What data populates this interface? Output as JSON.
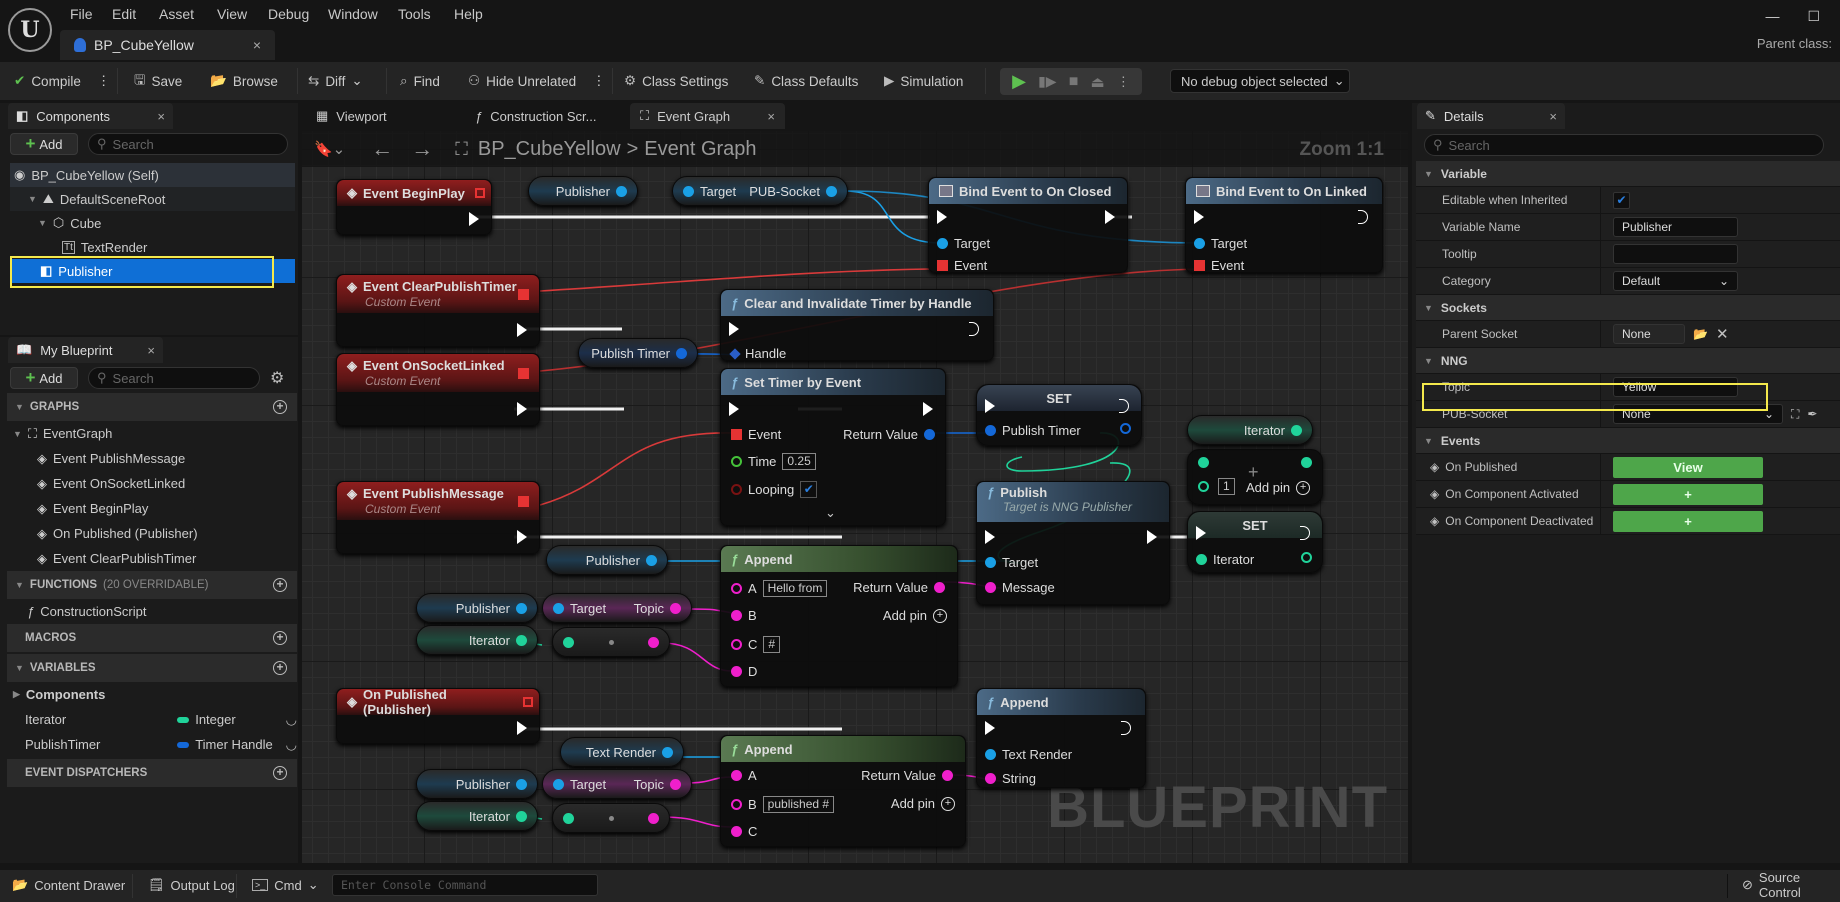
{
  "window": {
    "menu": [
      "File",
      "Edit",
      "Asset",
      "View",
      "Debug",
      "Window",
      "Tools",
      "Help"
    ],
    "doc_tab": "BP_CubeYellow",
    "parent_class_label": "Parent class:",
    "controls": {
      "minimize": "—",
      "maximize": "☐"
    }
  },
  "toolbar": {
    "compile": "Compile",
    "save": "Save",
    "browse": "Browse",
    "diff": "Diff",
    "find": "Find",
    "hide_unrelated": "Hide Unrelated",
    "class_settings": "Class Settings",
    "class_defaults": "Class Defaults",
    "simulation": "Simulation",
    "debug_object": "No debug object selected",
    "play_color": "#5ec150"
  },
  "components": {
    "tab": "Components",
    "add": "Add",
    "search_placeholder": "Search",
    "tree": [
      {
        "label": "BP_CubeYellow (Self)",
        "level": 0
      },
      {
        "label": "DefaultSceneRoot",
        "level": 1
      },
      {
        "label": "Cube",
        "level": 2
      },
      {
        "label": "TextRender",
        "level": 3
      },
      {
        "label": "Publisher",
        "level": 1,
        "selected": true
      }
    ]
  },
  "my_blueprint": {
    "tab": "My Blueprint",
    "add": "Add",
    "search_placeholder": "Search",
    "graphs_header": "GRAPHS",
    "event_graph": "EventGraph",
    "graph_items": [
      "Event PublishMessage",
      "Event OnSocketLinked",
      "Event BeginPlay",
      "On Published (Publisher)",
      "Event ClearPublishTimer"
    ],
    "functions_header": "FUNCTIONS",
    "functions_note": "(20 OVERRIDABLE)",
    "functions": [
      "ConstructionScript"
    ],
    "macros_header": "MACROS",
    "variables_header": "VARIABLES",
    "components_group": "Components",
    "variables": [
      {
        "name": "Iterator",
        "type": "Integer",
        "color": "#20d39a"
      },
      {
        "name": "PublishTimer",
        "type": "Timer Handle",
        "color": "#1468d8"
      }
    ],
    "dispatchers_header": "EVENT DISPATCHERS"
  },
  "graph_tabs": {
    "viewport": "Viewport",
    "construction": "Construction Scr...",
    "event_graph": "Event Graph"
  },
  "graph": {
    "breadcrumb_root": "BP_CubeYellow",
    "breadcrumb_sep": ">",
    "breadcrumb_leaf": "Event Graph",
    "zoom": "Zoom 1:1",
    "watermark": "BLUEPRINT",
    "nodes": {
      "begin_play": "Event BeginPlay",
      "clear_timer_event": "Event ClearPublishTimer",
      "socket_linked": "Event OnSocketLinked",
      "publish_message": "Event PublishMessage",
      "custom_event": "Custom Event",
      "on_published": "On Published (Publisher)",
      "bind_closed": "Bind Event to On Closed",
      "bind_linked": "Bind Event to On Linked",
      "clear_invalidate": "Clear and Invalidate Timer by Handle",
      "set_timer": "Set Timer by Event",
      "set": "SET",
      "publish": "Publish",
      "publish_sub": "Target is NNG Publisher",
      "append": "Append"
    },
    "pins": {
      "target": "Target",
      "event": "Event",
      "handle": "Handle",
      "time": "Time",
      "time_value": "0.25",
      "looping": "Looping",
      "return_value": "Return Value",
      "publish_timer": "Publish Timer",
      "message": "Message",
      "iterator": "Iterator",
      "add_pin": "Add pin",
      "one_value": "1",
      "a": "A",
      "b": "B",
      "c": "C",
      "d": "D",
      "hello_from": "Hello from",
      "hash": "#",
      "published_hash": "published #",
      "text_render": "Text Render",
      "string": "String",
      "topic": "Topic",
      "pub_socket": "PUB-Socket",
      "publisher": "Publisher"
    }
  },
  "details": {
    "tab": "Details",
    "search_placeholder": "Search",
    "variable_section": "Variable",
    "editable_inherited": "Editable when Inherited",
    "editable_checked": true,
    "variable_name_label": "Variable Name",
    "variable_name": "Publisher",
    "tooltip_label": "Tooltip",
    "tooltip_value": "",
    "category_label": "Category",
    "category_value": "Default",
    "sockets_section": "Sockets",
    "parent_socket_label": "Parent Socket",
    "parent_socket_value": "None",
    "nng_section": "NNG",
    "topic_label": "Topic",
    "topic_value": "Yellow",
    "pub_socket_label": "PUB-Socket",
    "pub_socket_value": "None",
    "events_section": "Events",
    "events": [
      {
        "label": "On Published",
        "button": "View"
      },
      {
        "label": "On Component Activated",
        "button": "+"
      },
      {
        "label": "On Component Deactivated",
        "button": "+"
      }
    ]
  },
  "statusbar": {
    "content_drawer": "Content Drawer",
    "output_log": "Output Log",
    "cmd": "Cmd",
    "console_placeholder": "Enter Console Command",
    "source_control": "Source Control"
  }
}
